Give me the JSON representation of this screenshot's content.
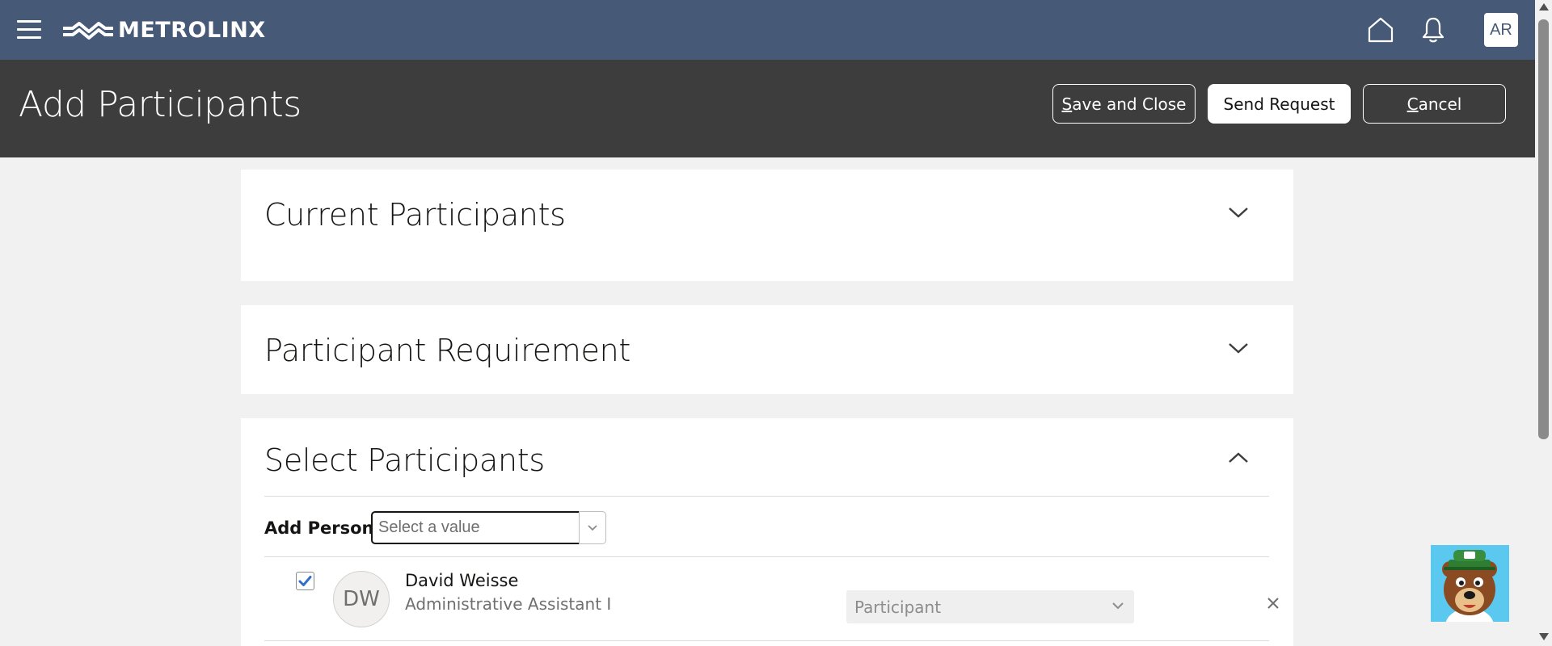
{
  "header": {
    "brand": "METROLINX",
    "user_initials": "AR"
  },
  "titlebar": {
    "title": "Add Participants",
    "save_close_hotkey": "S",
    "save_close_rest": "ave and Close",
    "send_request": "Send Request",
    "cancel_hotkey": "C",
    "cancel_rest": "ancel"
  },
  "sections": {
    "current": {
      "title": "Current Participants",
      "expanded": false
    },
    "requirement": {
      "title": "Participant Requirement",
      "expanded": false
    },
    "select": {
      "title": "Select Participants",
      "expanded": true
    }
  },
  "add_person": {
    "label": "Add Person",
    "placeholder": "Select a value",
    "value": ""
  },
  "participants": [
    {
      "checked": true,
      "initials": "DW",
      "name": "David Weisse",
      "job_title": "Administrative Assistant I",
      "role": "Participant"
    }
  ],
  "icons": {
    "menu": "hamburger-icon",
    "home": "home-icon",
    "notifications": "bell-icon",
    "collapse": "chevron-down-icon",
    "expand": "chevron-up-icon",
    "remove": "close-icon"
  },
  "colors": {
    "topbar": "#465a78",
    "titlebar": "#3d3d3d",
    "page_bg": "#f1f1f1",
    "check": "#2f6fc8"
  }
}
